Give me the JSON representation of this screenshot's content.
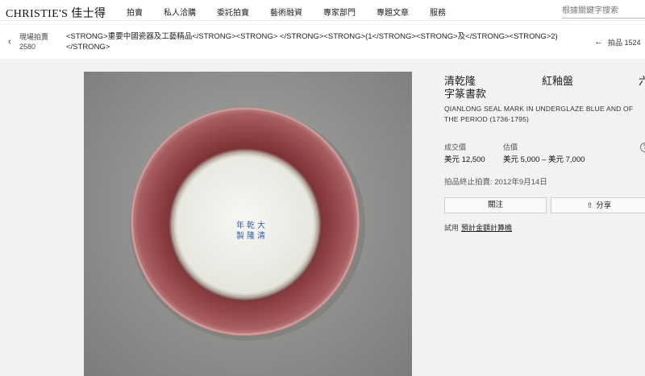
{
  "nav": {
    "logo": "CHRISTIE'S 佳士得",
    "items": [
      "拍賣",
      "私人洽購",
      "委託拍賣",
      "藝術融資",
      "專家部門",
      "專題文章",
      "服務"
    ],
    "search_placeholder": "根據關鍵字搜索"
  },
  "lot_nav": {
    "prev_label": "現場拍賣",
    "prev_number": "2580",
    "title": "<STRONG>重要中國瓷器及工藝精品</STRONG><STRONG> </STRONG><STRONG>(1</STRONG><STRONG>及</STRONG><STRONG>2)</STRONG>",
    "next_label": "拍品 1524"
  },
  "lot": {
    "title_cn_parts": [
      "清乾隆",
      "紅釉盤",
      "六",
      "字篆書款"
    ],
    "title_en": "QIANLONG SEAL MARK IN UNDERGLAZE BLUE AND OF THE PERIOD (1736-1795)",
    "price_realised_label": "成交價",
    "price_realised": "美元 12,500",
    "estimate_label": "估價",
    "estimate": "美元 5,000 – 美元 7,000",
    "closed_text": "拍品終止拍賣: 2012年9月14日",
    "follow_label": "關注",
    "share_label": "分享",
    "calc_prefix": "試用",
    "calc_link": "預計金額計算機",
    "seal_chars": [
      "大",
      "清",
      "乾",
      "隆",
      "年",
      "製"
    ]
  },
  "icons": {
    "back": "chevron-left-icon",
    "next": "arrow-left-icon",
    "share": "share-icon",
    "info": "info-icon"
  },
  "colors": {
    "glaze_red": "#8a3a3c",
    "seal_blue": "#3a5fa8",
    "background": "#f2f2f2"
  }
}
